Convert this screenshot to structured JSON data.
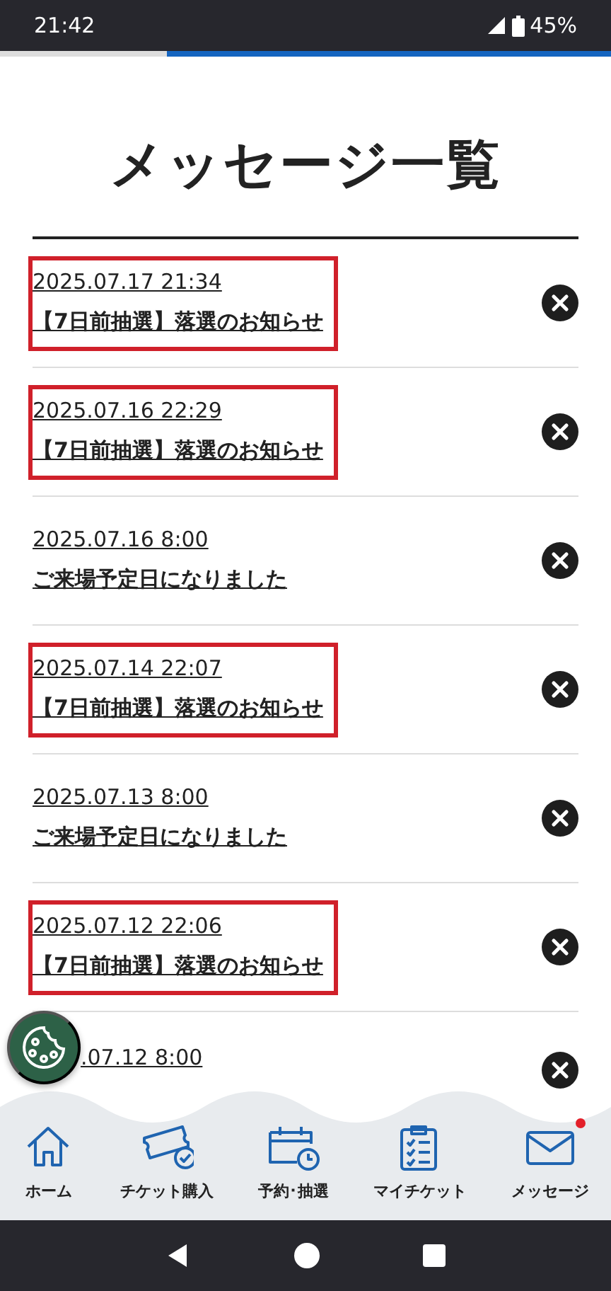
{
  "status_bar": {
    "time": "21:42",
    "battery": "45%"
  },
  "page_title": "メッセージ一覧",
  "messages": [
    {
      "date": "2025.07.17 21:34",
      "subject": "【7日前抽選】落選のお知らせ",
      "highlighted": true
    },
    {
      "date": "2025.07.16 22:29",
      "subject": "【7日前抽選】落選のお知らせ",
      "highlighted": true
    },
    {
      "date": "2025.07.16 8:00",
      "subject": "ご来場予定日になりました",
      "highlighted": false
    },
    {
      "date": "2025.07.14 22:07",
      "subject": "【7日前抽選】落選のお知らせ",
      "highlighted": true
    },
    {
      "date": "2025.07.13 8:00",
      "subject": "ご来場予定日になりました",
      "highlighted": false
    },
    {
      "date": "2025.07.12 22:06",
      "subject": "【7日前抽選】落選のお知らせ",
      "highlighted": true
    },
    {
      "date": ".07.12 8:00",
      "highlighted": false
    }
  ],
  "bottom_nav": [
    {
      "label": "ホーム",
      "kind": "home",
      "badge": false
    },
    {
      "label": "チケット購入",
      "kind": "ticket",
      "badge": false
    },
    {
      "label": "予約･抽選",
      "kind": "calendar",
      "badge": false
    },
    {
      "label": "マイチケット",
      "kind": "clipboard",
      "badge": false
    },
    {
      "label": "メッセージ",
      "kind": "mail",
      "badge": true
    }
  ]
}
